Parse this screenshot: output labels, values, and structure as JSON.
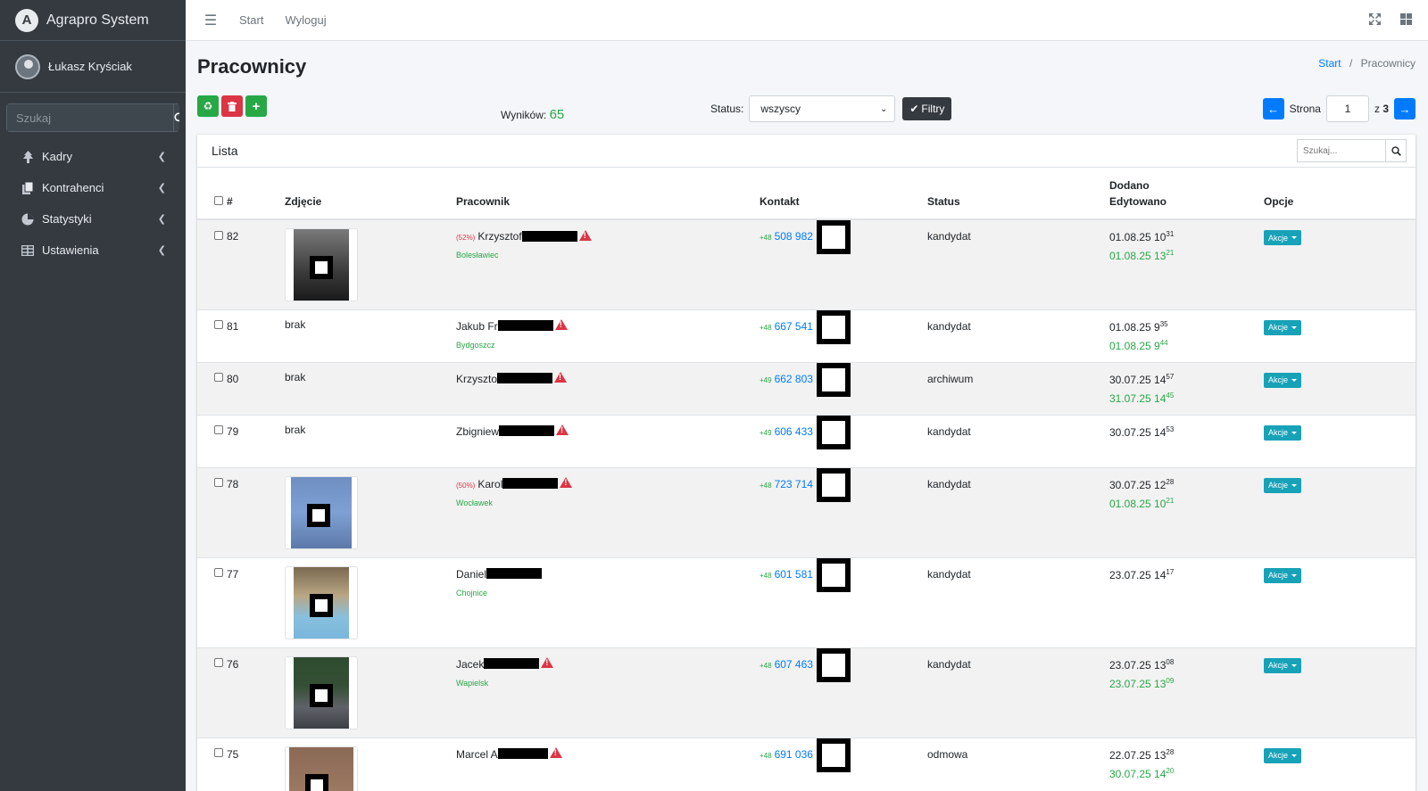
{
  "app": {
    "title": "Agrapro System",
    "logo_letter": "A"
  },
  "user": {
    "name": "Łukasz Kryściak"
  },
  "sidebar": {
    "search_placeholder": "Szukaj",
    "items": [
      {
        "label": "Kadry",
        "icon": "tree-icon"
      },
      {
        "label": "Kontrahenci",
        "icon": "copy-icon"
      },
      {
        "label": "Statystyki",
        "icon": "pie-chart-icon"
      },
      {
        "label": "Ustawienia",
        "icon": "table-icon"
      }
    ]
  },
  "topbar": {
    "start": "Start",
    "logout": "Wyloguj"
  },
  "page": {
    "title": "Pracownicy"
  },
  "breadcrumb": {
    "home": "Start",
    "separator": "/",
    "current": "Pracownicy"
  },
  "results": {
    "label": "Wyników:",
    "count": "65"
  },
  "filter": {
    "status_label": "Status:",
    "status_value": "wszyscy",
    "button": "Filtry"
  },
  "pager": {
    "label": "Strona",
    "page": "1",
    "of_label": "z",
    "total": "3"
  },
  "card": {
    "title": "Lista",
    "search_placeholder": "Szukaj..."
  },
  "table": {
    "headers": {
      "num": "#",
      "photo": "Zdjęcie",
      "worker": "Pracownik",
      "contact": "Kontakt",
      "status": "Status",
      "added": "Dodano",
      "edited": "Edytowano",
      "options": "Opcje"
    },
    "action_label": "Akcje",
    "no_photo": "brak",
    "rows": [
      {
        "id": "82",
        "photo": "p1",
        "pct": "(52%)",
        "name": "Krzysztof",
        "city": "Bolesławiec",
        "prefix": "+48",
        "phone": "508 982",
        "status": "kandydat",
        "added": "01.08.25 10",
        "added_min": "31",
        "edited": "01.08.25 13",
        "edited_min": "21"
      },
      {
        "id": "81",
        "photo": "",
        "pct": "",
        "name": "Jakub Fr",
        "city": "Bydgoszcz",
        "prefix": "+48",
        "phone": "667 541",
        "status": "kandydat",
        "added": "01.08.25 9",
        "added_min": "35",
        "edited": "01.08.25 9",
        "edited_min": "44"
      },
      {
        "id": "80",
        "photo": "",
        "pct": "",
        "name": "Krzyszto",
        "city": "",
        "prefix": "+49",
        "phone": "662 803",
        "status": "archiwum",
        "added": "30.07.25 14",
        "added_min": "57",
        "edited": "31.07.25 14",
        "edited_min": "45"
      },
      {
        "id": "79",
        "photo": "",
        "pct": "",
        "name": "Zbigniew",
        "city": "",
        "prefix": "+49",
        "phone": "606 433",
        "status": "kandydat",
        "added": "30.07.25 14",
        "added_min": "53",
        "edited": "",
        "edited_min": ""
      },
      {
        "id": "78",
        "photo": "p2",
        "pct": "(50%)",
        "name": "Karol",
        "city": "Wocławek",
        "prefix": "+48",
        "phone": "723 714",
        "status": "kandydat",
        "added": "30.07.25 12",
        "added_min": "28",
        "edited": "01.08.25 10",
        "edited_min": "21"
      },
      {
        "id": "77",
        "photo": "p3",
        "pct": "",
        "name": "Daniel",
        "city": "Chojnice",
        "prefix": "+48",
        "phone": "601 581",
        "status": "kandydat",
        "added": "23.07.25 14",
        "added_min": "17",
        "edited": "",
        "edited_min": ""
      },
      {
        "id": "76",
        "photo": "p4",
        "pct": "",
        "name": "Jacek",
        "city": "Wapielsk",
        "prefix": "+48",
        "phone": "607 463",
        "status": "kandydat",
        "added": "23.07.25 13",
        "added_min": "08",
        "edited": "23.07.25 13",
        "edited_min": "09"
      },
      {
        "id": "75",
        "photo": "p5",
        "pct": "",
        "name": "Marcel A",
        "city": "",
        "prefix": "+48",
        "phone": "691 036",
        "status": "odmowa",
        "added": "22.07.25 13",
        "added_min": "28",
        "edited": "30.07.25 14",
        "edited_min": "20"
      }
    ]
  }
}
